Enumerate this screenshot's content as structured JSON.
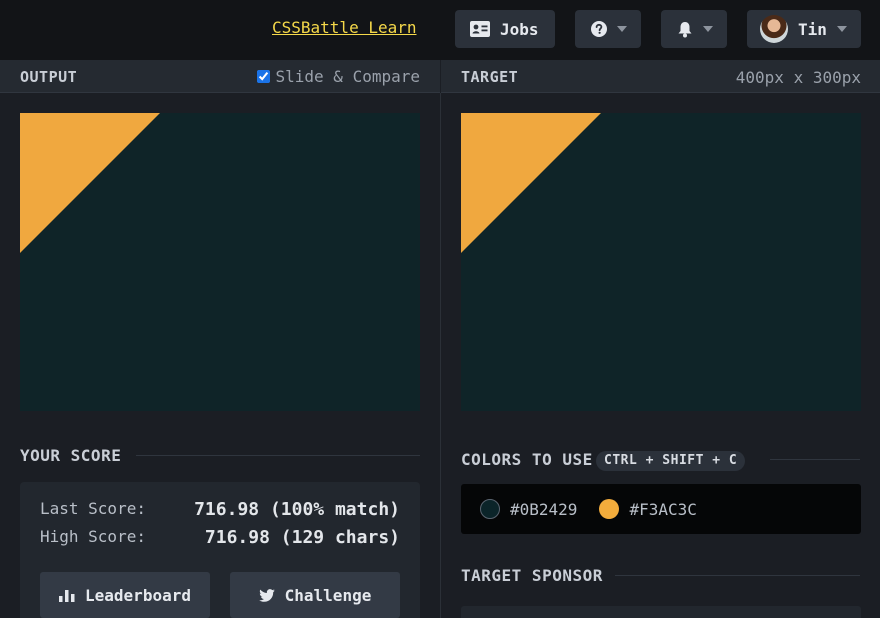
{
  "topbar": {
    "learn_link": "CSSBattle Learn",
    "jobs_label": "Jobs",
    "user_name": "Tin"
  },
  "output": {
    "title": "OUTPUT",
    "compare_label": "Slide & Compare",
    "compare_checked": true
  },
  "target": {
    "title": "TARGET",
    "dimensions": "400px x 300px"
  },
  "score": {
    "title": "YOUR SCORE",
    "last_label": "Last Score:",
    "last_value": "716.98 (100% match)",
    "high_label": "High Score:",
    "high_value": "716.98 (129 chars)",
    "leaderboard_label": "Leaderboard",
    "challenge_label": "Challenge"
  },
  "colors": {
    "title": "COLORS TO USE",
    "shortcut": "CTRL + SHIFT + C",
    "items": [
      {
        "hex": "#0B2429"
      },
      {
        "hex": "#F3AC3C"
      }
    ]
  },
  "sponsor": {
    "title": "TARGET SPONSOR"
  },
  "icons": [
    "id-card-icon",
    "question-icon",
    "bell-icon",
    "bar-chart-icon",
    "twitter-icon"
  ]
}
